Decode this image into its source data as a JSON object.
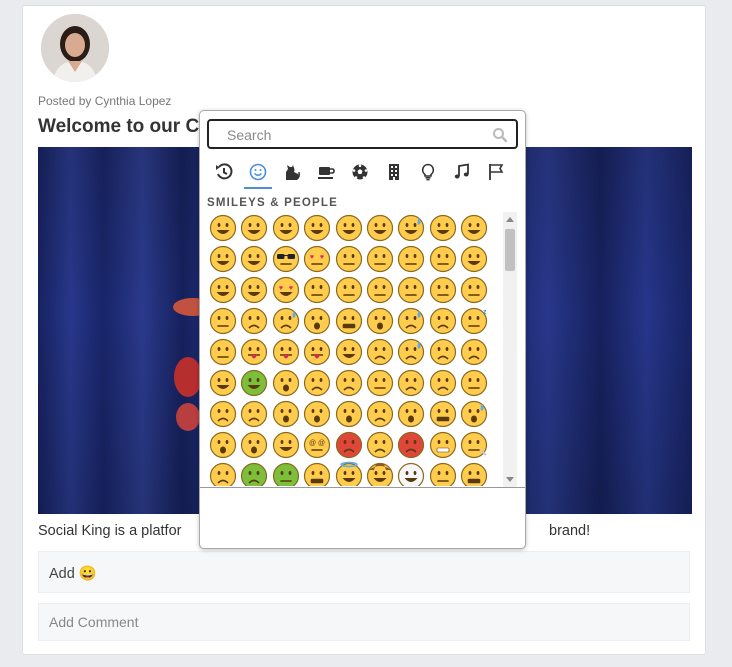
{
  "post": {
    "posted_by": "Posted by Cynthia Lopez",
    "title": "Welcome to our C",
    "caption": "Social King is a platfor",
    "caption_tail": "brand!",
    "add_label": "Add 😀",
    "comment_placeholder": "Add Comment"
  },
  "picker": {
    "search_placeholder": "Search",
    "section_title": "SMILEYS & PEOPLE",
    "active_category": "smileys",
    "categories": [
      {
        "name": "recent",
        "icon": "history-icon"
      },
      {
        "name": "smileys",
        "icon": "smiley-icon"
      },
      {
        "name": "animals",
        "icon": "cat-icon"
      },
      {
        "name": "food",
        "icon": "coffee-icon"
      },
      {
        "name": "activity",
        "icon": "soccer-ball-icon"
      },
      {
        "name": "travel",
        "icon": "building-icon"
      },
      {
        "name": "objects",
        "icon": "lightbulb-icon"
      },
      {
        "name": "symbols",
        "icon": "music-note-icon"
      },
      {
        "name": "flags",
        "icon": "flag-icon"
      }
    ],
    "emoji_rows": [
      [
        "grinning",
        "grin",
        "joy",
        "rofl",
        "smiley",
        "smile",
        "sweat-smile",
        "laughing",
        "wink"
      ],
      [
        "blush",
        "yum",
        "sunglasses",
        "heart-eyes",
        "kissing-heart",
        "kissing",
        "kissing-smiling",
        "kissing-closed-eyes",
        "relaxed"
      ],
      [
        "slight-smile",
        "hugging",
        "star-struck",
        "thinking",
        "raised-eyebrow",
        "neutral",
        "expressionless",
        "no-mouth",
        "eye-roll"
      ],
      [
        "smirk",
        "persevere",
        "disappointed-relieved",
        "open-mouth",
        "zipper-mouth",
        "hushed",
        "sleepy",
        "tired",
        "sleeping"
      ],
      [
        "relieved",
        "stuck-out-tongue",
        "winking-tongue",
        "squinting-tongue",
        "drooling",
        "unamused",
        "sweat",
        "pensive",
        "confused"
      ],
      [
        "upside-down",
        "money-mouth",
        "astonished",
        "frowning",
        "slight-frown",
        "confounded",
        "disappointed",
        "worried",
        "triumph"
      ],
      [
        "cry",
        "sob",
        "frowning-open",
        "anguished",
        "fearful",
        "weary",
        "exploding-head",
        "grimacing",
        "cold-sweat"
      ],
      [
        "scream",
        "flushed",
        "zany",
        "dizzy",
        "pouting",
        "angry",
        "cursing",
        "mask",
        "thermometer-face"
      ],
      [
        "head-bandage",
        "nauseated",
        "vomiting",
        "sneezing",
        "innocent",
        "cowboy",
        "clown",
        "lying",
        "shushing"
      ]
    ],
    "colors": {
      "accent": "#4a90d9",
      "emoji_yellow": "#ffcc4d",
      "emoji_outline": "#8a6a1e"
    }
  }
}
